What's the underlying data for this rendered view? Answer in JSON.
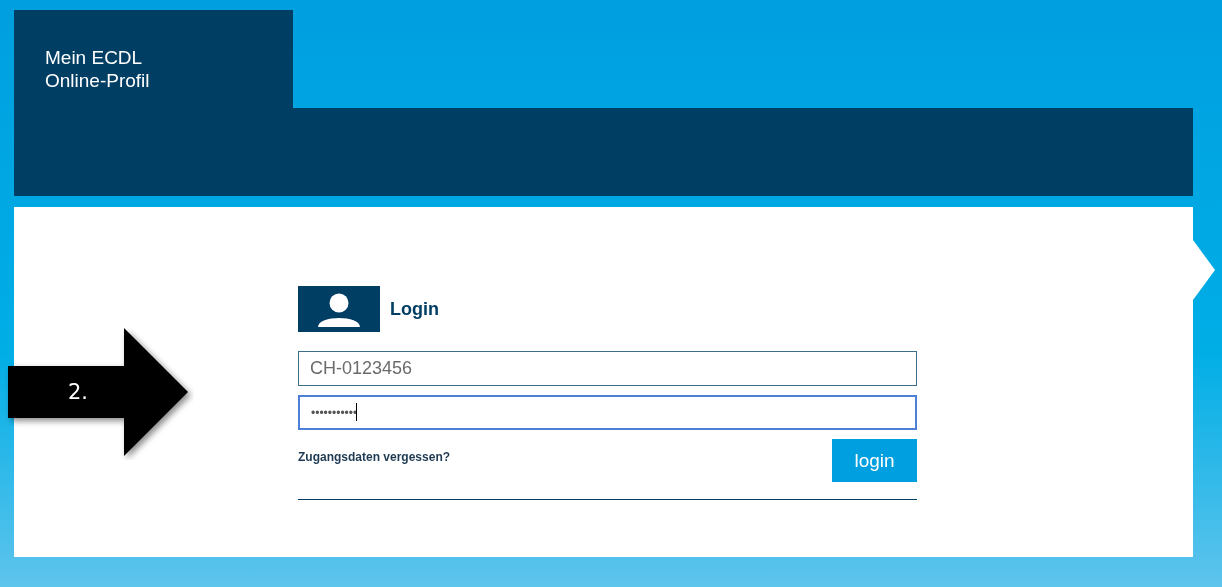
{
  "header": {
    "title_lines": [
      "Mein ECDL",
      "Online-Profil"
    ]
  },
  "login": {
    "heading": "Login",
    "fields": [
      {
        "kind": "text",
        "value": "CH-0123456",
        "focused": false
      },
      {
        "kind": "password",
        "value": "•••••••••••",
        "focused": true
      }
    ],
    "forgot_link": "Zugangsdaten vergessen?",
    "button": "login"
  },
  "annotation": {
    "label": "2."
  }
}
